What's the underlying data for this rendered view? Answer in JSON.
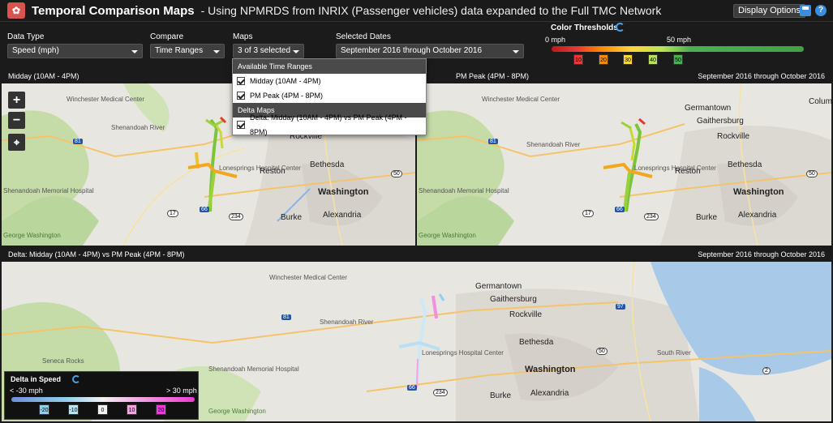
{
  "header": {
    "title": "Temporal Comparison Maps",
    "subtitle": "- Using NPMRDS from INRIX (Passenger vehicles) data expanded to the Full TMC Network",
    "display_options": "Display Options"
  },
  "controls": {
    "data_type": {
      "label": "Data Type",
      "value": "Speed (mph)"
    },
    "compare": {
      "label": "Compare",
      "value": "Time Ranges"
    },
    "maps": {
      "label": "Maps",
      "value": "3 of 3 selected"
    },
    "dates": {
      "label": "Selected Dates",
      "value": "September 2016 through October 2016"
    }
  },
  "thresholds": {
    "title": "Color Thresholds",
    "min_label": "0 mph",
    "max_label": "50 mph",
    "markers": [
      {
        "value": "10",
        "color": "#e53935"
      },
      {
        "value": "20",
        "color": "#fb8c00"
      },
      {
        "value": "30",
        "color": "#fdd835"
      },
      {
        "value": "40",
        "color": "#b9e35a"
      },
      {
        "value": "50",
        "color": "#4caf50"
      }
    ]
  },
  "dropdown": {
    "section1": "Available Time Ranges",
    "items1": [
      "Midday (10AM - 4PM)",
      "PM Peak (4PM - 8PM)"
    ],
    "section2": "Delta Maps",
    "items2": [
      "Delta: Midday (10AM - 4PM) vs PM Peak (4PM - 8PM)"
    ]
  },
  "panels": {
    "midday": {
      "title": "Midday (10AM - 4PM)"
    },
    "pm": {
      "title": "PM Peak (4PM - 8PM)",
      "dates": "September 2016 through October 2016"
    },
    "delta": {
      "title": "Delta: Midday (10AM - 4PM) vs PM Peak (4PM - 8PM)",
      "dates": "September 2016 through October 2016"
    }
  },
  "map_labels": {
    "winchester": "Winchester Medical Center",
    "shenandoah": "Shenandoah River",
    "germantown": "Germantown",
    "gaithersburg": "Gaithersburg",
    "rockville": "Rockville",
    "reston": "Reston",
    "bethesda": "Bethesda",
    "washington": "Washington",
    "burke": "Burke",
    "alexandria": "Alexandria",
    "columbia": "Columbia",
    "lonesprings": "Lonesprings Hospital Center",
    "shenandoah_memorial": "Shenandoah Memorial Hospital",
    "george_washington": "George Washington",
    "seneca": "Seneca Rocks",
    "south_river": "South River"
  },
  "zoom": {
    "in": "+",
    "out": "−"
  },
  "delta_legend": {
    "title": "Delta in Speed",
    "min_label": "< -30 mph",
    "max_label": "> 30 mph",
    "markers": [
      {
        "value": "-20",
        "color": "#8ed0f0"
      },
      {
        "value": "-10",
        "color": "#b8e6f7"
      },
      {
        "value": "0",
        "color": "#f2f2f2"
      },
      {
        "value": "10",
        "color": "#f6a3e4"
      },
      {
        "value": "20",
        "color": "#e93bd9"
      }
    ]
  }
}
